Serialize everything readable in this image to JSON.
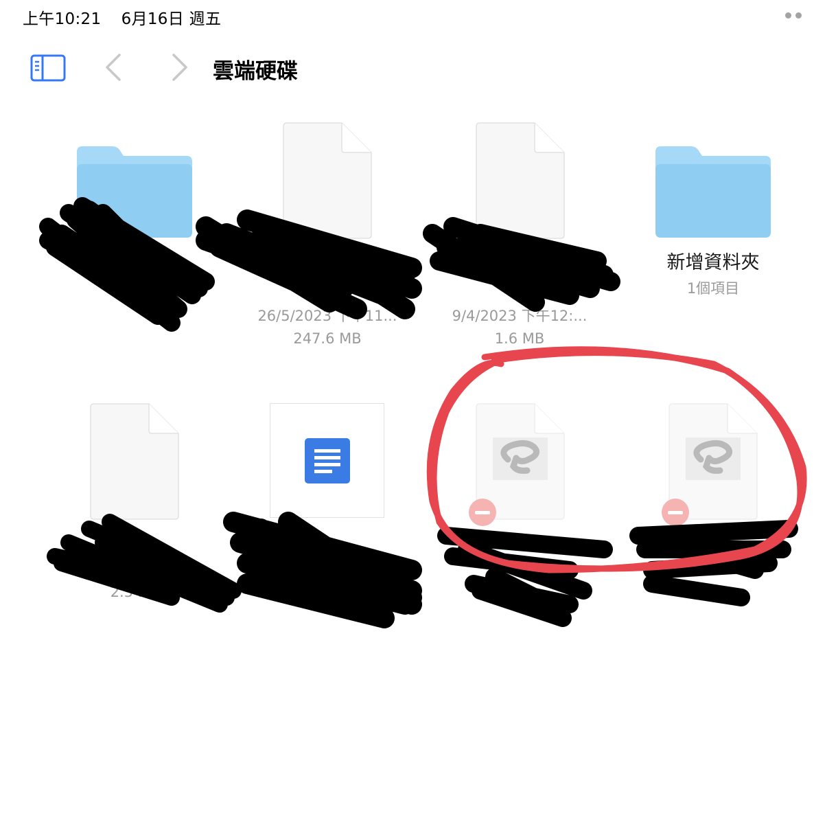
{
  "status_bar": {
    "time": "上午10:21",
    "date": "6月16日 週五"
  },
  "toolbar": {
    "sidebar_icon": "sidebar-toggle-icon",
    "back_icon": "chevron-left-icon",
    "forward_icon": "chevron-right-icon",
    "title": "雲端硬碟"
  },
  "items": [
    {
      "kind": "folder",
      "name": "",
      "meta1": "",
      "meta2": ""
    },
    {
      "kind": "file",
      "name": "",
      "meta1": "26/5/2023 下午11...",
      "meta2": "247.6 MB"
    },
    {
      "kind": "file",
      "name": "",
      "meta1": "9/4/2023 下午12:...",
      "meta2": "1.6 MB"
    },
    {
      "kind": "folder",
      "name": "新增資料夾",
      "meta1": "1個項目",
      "meta2": ""
    },
    {
      "kind": "file",
      "name": "",
      "meta1": "",
      "meta2": "2.5 MB"
    },
    {
      "kind": "google-doc",
      "name": "",
      "meta1": "",
      "meta2": ""
    },
    {
      "kind": "clip-studio-file",
      "name": "",
      "meta1": "",
      "meta2": ""
    },
    {
      "kind": "clip-studio-file",
      "name": "",
      "meta1": "",
      "meta2": ""
    }
  ],
  "colors": {
    "accent": "#3478f6",
    "folder_light": "#a6d8f7",
    "folder_dark": "#8fcdf2",
    "annotation_red": "#e8464f",
    "remove_badge": "#f5b3b2",
    "gdoc_blue": "#3b7be4"
  }
}
